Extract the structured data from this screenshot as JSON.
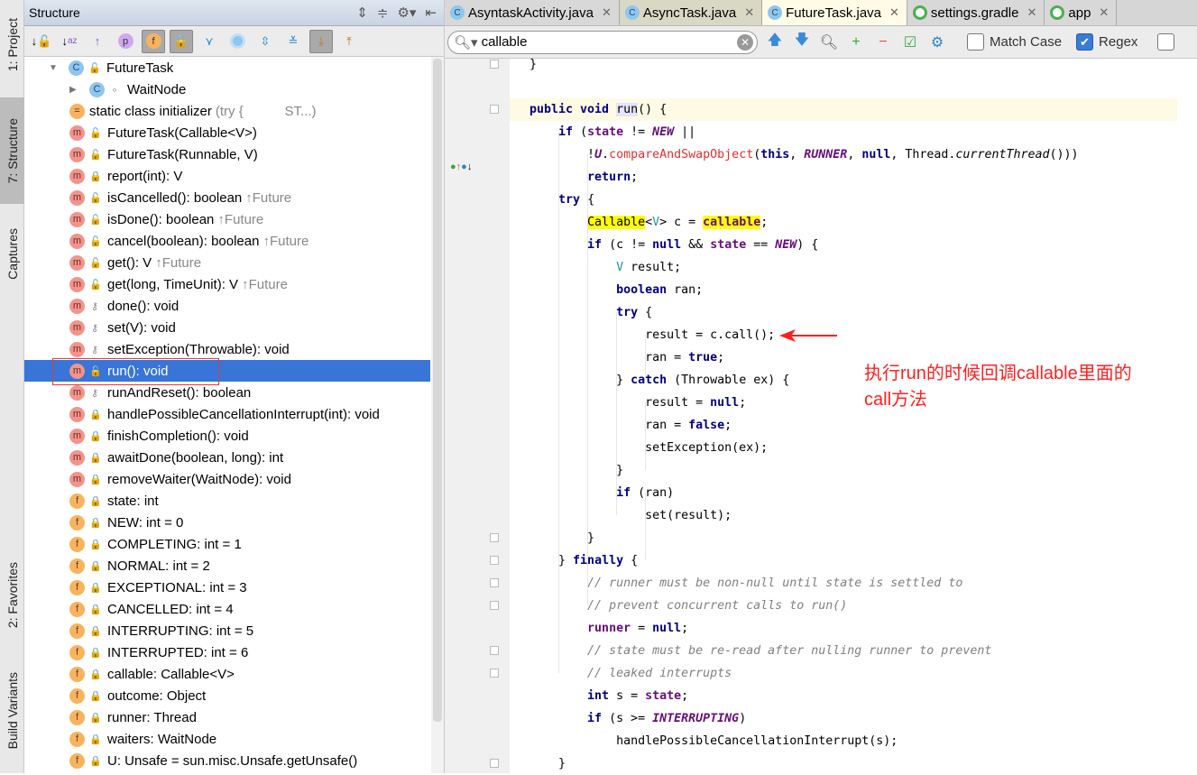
{
  "sidebar_tabs": [
    "1: Project",
    "7: Structure",
    "Captures",
    "2: Favorites",
    "Build Variants"
  ],
  "structure": {
    "title": "Structure",
    "tree": [
      {
        "icon": "c",
        "vis": "pub",
        "label": "FutureTask",
        "arrow": "down",
        "indent": 0
      },
      {
        "icon": "c",
        "vis": "pkg",
        "label": "WaitNode",
        "arrow": "right",
        "indent": 1
      },
      {
        "icon": "s",
        "vis": "",
        "label": "static class initializer",
        "dim": "(try {           ST...)",
        "indent": 1
      },
      {
        "icon": "m",
        "vis": "pub",
        "label": "FutureTask(Callable<V>)",
        "indent": 1
      },
      {
        "icon": "m",
        "vis": "pub",
        "label": "FutureTask(Runnable, V)",
        "indent": 1
      },
      {
        "icon": "m",
        "vis": "pri",
        "label": "report(int): V",
        "indent": 1
      },
      {
        "icon": "m",
        "vis": "pub",
        "label": "isCancelled(): boolean",
        "dim": "↑Future",
        "indent": 1
      },
      {
        "icon": "m",
        "vis": "pub",
        "label": "isDone(): boolean",
        "dim": "↑Future",
        "indent": 1
      },
      {
        "icon": "m",
        "vis": "pub",
        "label": "cancel(boolean): boolean",
        "dim": "↑Future",
        "indent": 1
      },
      {
        "icon": "m",
        "vis": "pub",
        "label": "get(): V",
        "dim": "↑Future",
        "indent": 1
      },
      {
        "icon": "m",
        "vis": "pub",
        "label": "get(long, TimeUnit): V",
        "dim": "↑Future",
        "indent": 1
      },
      {
        "icon": "m",
        "vis": "pro",
        "label": "done(): void",
        "indent": 1
      },
      {
        "icon": "m",
        "vis": "pro",
        "label": "set(V): void",
        "indent": 1
      },
      {
        "icon": "m",
        "vis": "pro",
        "label": "setException(Throwable): void",
        "indent": 1
      },
      {
        "icon": "m",
        "vis": "pub",
        "label": "run(): void",
        "indent": 1,
        "selected": true
      },
      {
        "icon": "m",
        "vis": "pro",
        "label": "runAndReset(): boolean",
        "indent": 1
      },
      {
        "icon": "m",
        "vis": "pri",
        "label": "handlePossibleCancellationInterrupt(int): void",
        "indent": 1
      },
      {
        "icon": "m",
        "vis": "pri",
        "label": "finishCompletion(): void",
        "indent": 1
      },
      {
        "icon": "m",
        "vis": "pri",
        "label": "awaitDone(boolean, long): int",
        "indent": 1
      },
      {
        "icon": "m",
        "vis": "pri",
        "label": "removeWaiter(WaitNode): void",
        "indent": 1
      },
      {
        "icon": "f",
        "vis": "pri",
        "label": "state: int",
        "indent": 1
      },
      {
        "icon": "f",
        "vis": "pri",
        "label": "NEW: int = 0",
        "indent": 1
      },
      {
        "icon": "f",
        "vis": "pri",
        "label": "COMPLETING: int = 1",
        "indent": 1
      },
      {
        "icon": "f",
        "vis": "pri",
        "label": "NORMAL: int = 2",
        "indent": 1
      },
      {
        "icon": "f",
        "vis": "pri",
        "label": "EXCEPTIONAL: int = 3",
        "indent": 1
      },
      {
        "icon": "f",
        "vis": "pri",
        "label": "CANCELLED: int = 4",
        "indent": 1
      },
      {
        "icon": "f",
        "vis": "pri",
        "label": "INTERRUPTING: int = 5",
        "indent": 1
      },
      {
        "icon": "f",
        "vis": "pri",
        "label": "INTERRUPTED: int = 6",
        "indent": 1
      },
      {
        "icon": "f",
        "vis": "pri",
        "label": "callable: Callable<V>",
        "indent": 1
      },
      {
        "icon": "f",
        "vis": "pri",
        "label": "outcome: Object",
        "indent": 1
      },
      {
        "icon": "f",
        "vis": "pri",
        "label": "runner: Thread",
        "indent": 1
      },
      {
        "icon": "f",
        "vis": "pri",
        "label": "waiters: WaitNode",
        "indent": 1
      },
      {
        "icon": "f",
        "vis": "pri",
        "label": "U: Unsafe = sun.misc.Unsafe.getUnsafe()",
        "indent": 1
      }
    ]
  },
  "editor": {
    "tabs": [
      {
        "label": "AsyntaskActivity.java",
        "icon": "class"
      },
      {
        "label": "AsyncTask.java",
        "icon": "class"
      },
      {
        "label": "FutureTask.java",
        "icon": "class",
        "active": true
      },
      {
        "label": "settings.gradle",
        "icon": "gradle"
      },
      {
        "label": "app",
        "icon": "gradle"
      }
    ],
    "find": {
      "query": "callable",
      "match_case_label": "Match Case",
      "match_case": false,
      "regex_label": "Regex",
      "regex": true
    },
    "code": [
      {
        "i": 0,
        "t": [
          [
            "}",
            ""
          ]
        ]
      },
      {
        "i": 0,
        "t": []
      },
      {
        "i": 0,
        "cur": true,
        "t": [
          [
            "public void ",
            "kw"
          ],
          [
            "run",
            "hlr"
          ],
          [
            "() {",
            ""
          ]
        ]
      },
      {
        "i": 1,
        "t": [
          [
            "if ",
            "kw"
          ],
          [
            "(",
            ""
          ],
          [
            "state",
            "fld"
          ],
          [
            " != ",
            ""
          ],
          [
            "NEW",
            "cst"
          ],
          [
            " ||",
            ""
          ]
        ]
      },
      {
        "i": 2,
        "t": [
          [
            "!",
            ""
          ],
          [
            "U",
            "cst"
          ],
          [
            ".",
            ""
          ],
          [
            "compareAndSwapObject",
            "mth"
          ],
          [
            "(",
            ""
          ],
          [
            "this",
            "kw"
          ],
          [
            ", ",
            ""
          ],
          [
            "RUNNER",
            "cst"
          ],
          [
            ", ",
            ""
          ],
          [
            "null",
            "kw"
          ],
          [
            ", Thread.",
            ""
          ],
          [
            "currentThread",
            "ital"
          ],
          [
            "()))",
            ""
          ]
        ]
      },
      {
        "i": 2,
        "t": [
          [
            "return",
            "kw"
          ],
          [
            ";",
            ""
          ]
        ]
      },
      {
        "i": 1,
        "t": [
          [
            "try ",
            "kw"
          ],
          [
            "{",
            ""
          ]
        ]
      },
      {
        "i": 2,
        "t": [
          [
            "Callable",
            "hl"
          ],
          [
            "<",
            ""
          ],
          [
            "V",
            "tp"
          ],
          [
            "> c = ",
            ""
          ],
          [
            "callable",
            "fld hl"
          ],
          [
            ";",
            ""
          ]
        ]
      },
      {
        "i": 2,
        "t": [
          [
            "if ",
            "kw"
          ],
          [
            "(c != ",
            ""
          ],
          [
            "null",
            "kw"
          ],
          [
            " && ",
            ""
          ],
          [
            "state",
            "fld"
          ],
          [
            " == ",
            ""
          ],
          [
            "NEW",
            "cst"
          ],
          [
            ") {",
            ""
          ]
        ]
      },
      {
        "i": 3,
        "t": [
          [
            "V",
            "tp"
          ],
          [
            " result;",
            ""
          ]
        ]
      },
      {
        "i": 3,
        "t": [
          [
            "boolean ",
            "kw"
          ],
          [
            "ran;",
            ""
          ]
        ]
      },
      {
        "i": 3,
        "t": [
          [
            "try ",
            "kw"
          ],
          [
            "{",
            ""
          ]
        ]
      },
      {
        "i": 4,
        "t": [
          [
            "result = c.call();",
            ""
          ]
        ]
      },
      {
        "i": 4,
        "t": [
          [
            "ran = ",
            ""
          ],
          [
            "true",
            "kw"
          ],
          [
            ";",
            ""
          ]
        ]
      },
      {
        "i": 3,
        "t": [
          [
            "} ",
            ""
          ],
          [
            "catch ",
            "kw"
          ],
          [
            "(Throwable ex) {",
            ""
          ]
        ]
      },
      {
        "i": 4,
        "t": [
          [
            "result = ",
            ""
          ],
          [
            "null",
            "kw"
          ],
          [
            ";",
            ""
          ]
        ]
      },
      {
        "i": 4,
        "t": [
          [
            "ran = ",
            ""
          ],
          [
            "false",
            "kw"
          ],
          [
            ";",
            ""
          ]
        ]
      },
      {
        "i": 4,
        "t": [
          [
            "setException(ex);",
            ""
          ]
        ]
      },
      {
        "i": 3,
        "t": [
          [
            "}",
            ""
          ]
        ]
      },
      {
        "i": 3,
        "t": [
          [
            "if ",
            "kw"
          ],
          [
            "(ran)",
            ""
          ]
        ]
      },
      {
        "i": 4,
        "t": [
          [
            "set(result);",
            ""
          ]
        ]
      },
      {
        "i": 2,
        "t": [
          [
            "}",
            ""
          ]
        ]
      },
      {
        "i": 1,
        "t": [
          [
            "} ",
            ""
          ],
          [
            "finally ",
            "kw"
          ],
          [
            "{",
            ""
          ]
        ]
      },
      {
        "i": 2,
        "t": [
          [
            "// runner must be non-null until state is settled to",
            "cmt"
          ]
        ]
      },
      {
        "i": 2,
        "t": [
          [
            "// prevent concurrent calls to run()",
            "cmt"
          ]
        ]
      },
      {
        "i": 2,
        "t": [
          [
            "runner",
            "fld"
          ],
          [
            " = ",
            ""
          ],
          [
            "null",
            "kw"
          ],
          [
            ";",
            ""
          ]
        ]
      },
      {
        "i": 2,
        "t": [
          [
            "// state must be re-read after nulling runner to prevent",
            "cmt"
          ]
        ]
      },
      {
        "i": 2,
        "t": [
          [
            "// leaked interrupts",
            "cmt"
          ]
        ]
      },
      {
        "i": 2,
        "t": [
          [
            "int ",
            "kw"
          ],
          [
            "s = ",
            ""
          ],
          [
            "state",
            "fld"
          ],
          [
            ";",
            ""
          ]
        ]
      },
      {
        "i": 2,
        "t": [
          [
            "if ",
            "kw"
          ],
          [
            "(s >= ",
            ""
          ],
          [
            "INTERRUPTING",
            "cst"
          ],
          [
            ")",
            ""
          ]
        ]
      },
      {
        "i": 3,
        "t": [
          [
            "handlePossibleCancellationInterrupt(s);",
            ""
          ]
        ]
      },
      {
        "i": 1,
        "t": [
          [
            "}",
            ""
          ]
        ]
      }
    ]
  },
  "annotation": {
    "line1": "执行run的时候回调callable里面的",
    "line2": "call方法",
    "color": "#ff2020"
  }
}
